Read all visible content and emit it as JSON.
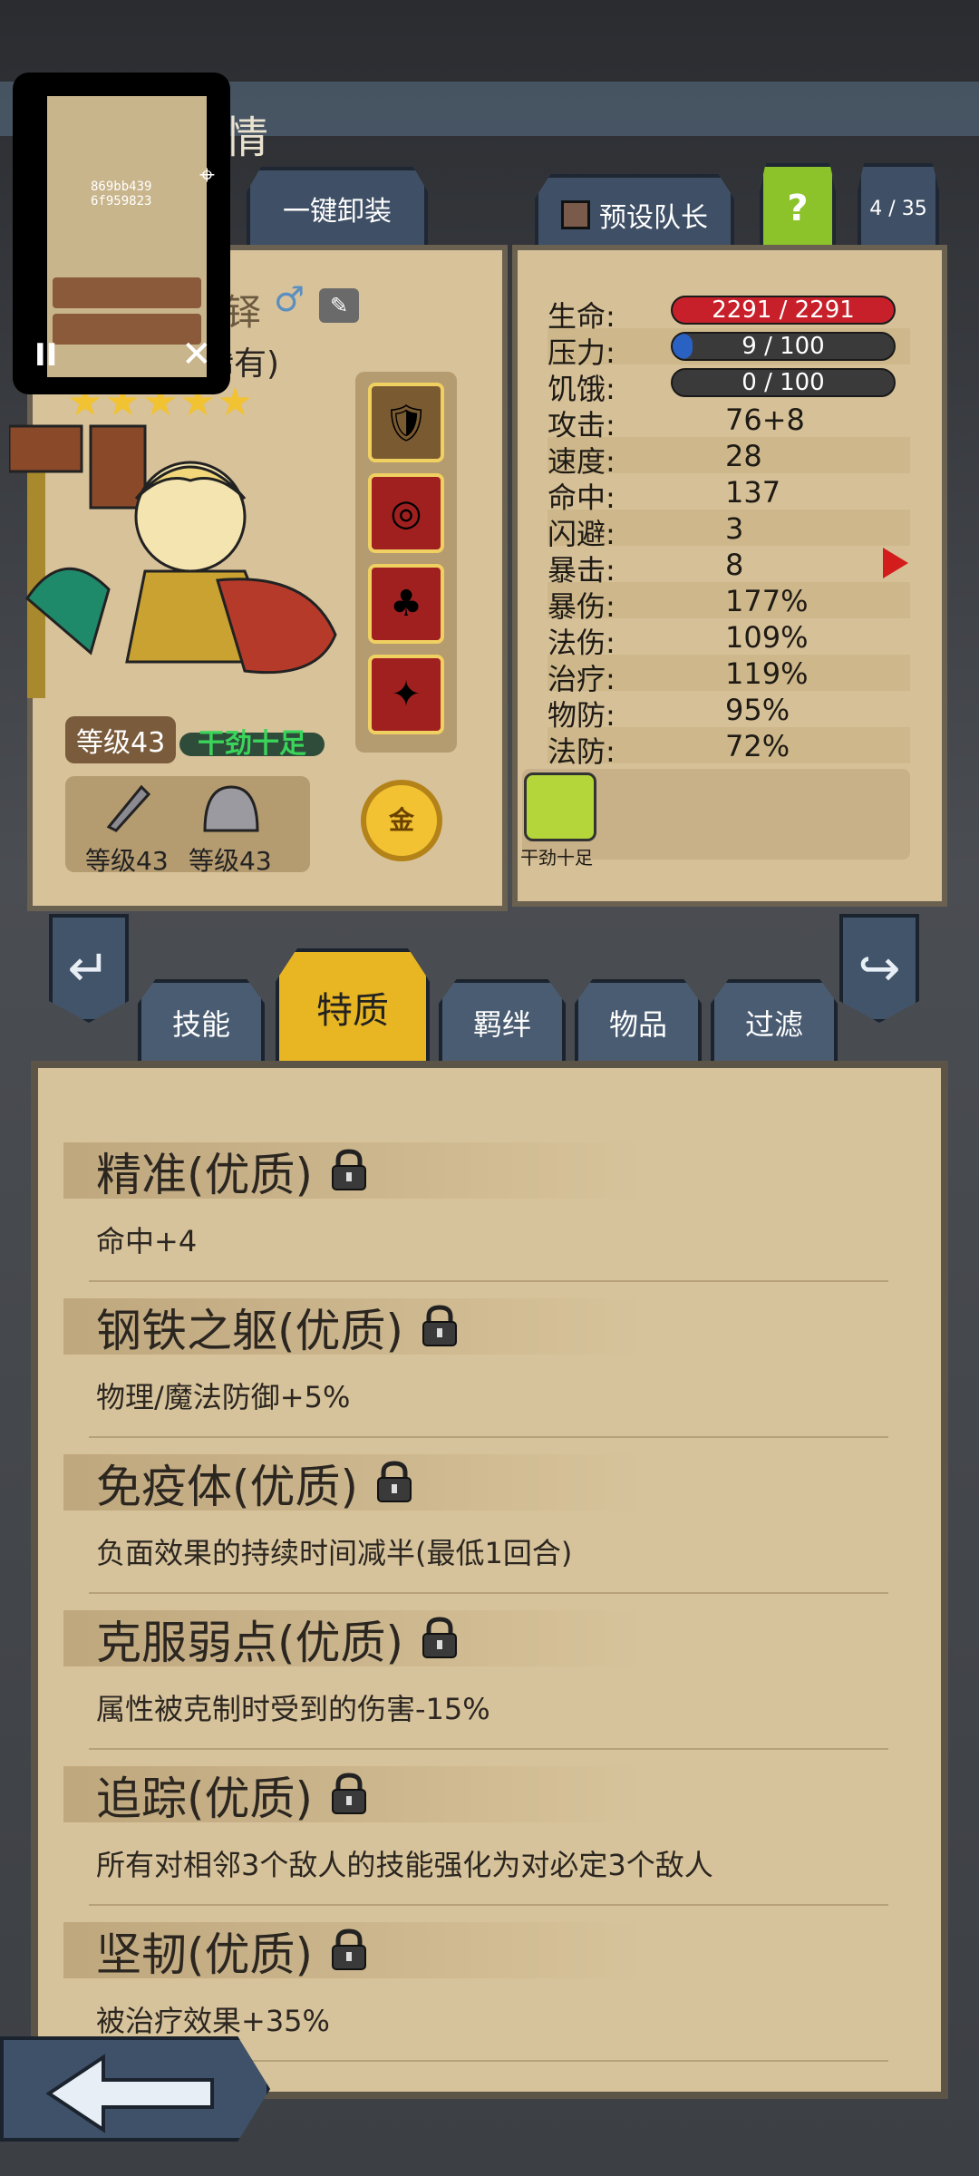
{
  "header": {
    "title_fragment": "情"
  },
  "overlay": {
    "id_line1": "869bb439",
    "id_line2": "6f959823",
    "pause": "II",
    "close": "✕"
  },
  "toolbar": {
    "unload_all": "一键卸装",
    "preset_leader": "预设队长",
    "help": "?",
    "roster_count": "4 / 35"
  },
  "character": {
    "name_fragment": "铎",
    "gender_symbol": "♂",
    "rarity": "稀有)",
    "stars": "★★★★★",
    "level": "等级43",
    "status": "干劲十足",
    "weapon_level": "等级43",
    "helmet_level": "等级43",
    "gold_badge": "金"
  },
  "stats": {
    "hp": {
      "label": "生命:",
      "value": "2291 / 2291",
      "fill": 1.0,
      "color": "#c8202a"
    },
    "stress": {
      "label": "压力:",
      "value": "9 / 100",
      "fill": 0.09,
      "color": "#2a62c4"
    },
    "hunger": {
      "label": "饥饿:",
      "value": "0 / 100",
      "fill": 0.0,
      "color": "#e09020"
    },
    "rows": [
      {
        "label": "攻击:",
        "value": "76+8"
      },
      {
        "label": "速度:",
        "value": "28"
      },
      {
        "label": "命中:",
        "value": "137"
      },
      {
        "label": "闪避:",
        "value": "3"
      },
      {
        "label": "暴击:",
        "value": "8"
      },
      {
        "label": "暴伤:",
        "value": "177%"
      },
      {
        "label": "法伤:",
        "value": "109%"
      },
      {
        "label": "治疗:",
        "value": "119%"
      },
      {
        "label": "物防:",
        "value": "95%"
      },
      {
        "label": "法防:",
        "value": "72%"
      }
    ],
    "buff_label": "干劲十足"
  },
  "tabs": [
    {
      "label": "技能"
    },
    {
      "label": "特质"
    },
    {
      "label": "羁绊"
    },
    {
      "label": "物品"
    },
    {
      "label": "过滤"
    }
  ],
  "traits": [
    {
      "name": "精准(优质)",
      "desc": "命中+4"
    },
    {
      "name": "钢铁之躯(优质)",
      "desc": "物理/魔法防御+5%"
    },
    {
      "name": "免疫体(优质)",
      "desc": "负面效果的持续时间减半(最低1回合)"
    },
    {
      "name": "克服弱点(优质)",
      "desc": "属性被克制时受到的伤害-15%"
    },
    {
      "name": "追踪(优质)",
      "desc": "所有对相邻3个敌人的技能强化为对必定3个敌人"
    },
    {
      "name": "坚韧(优质)",
      "desc": "被治疗效果+35%"
    }
  ]
}
